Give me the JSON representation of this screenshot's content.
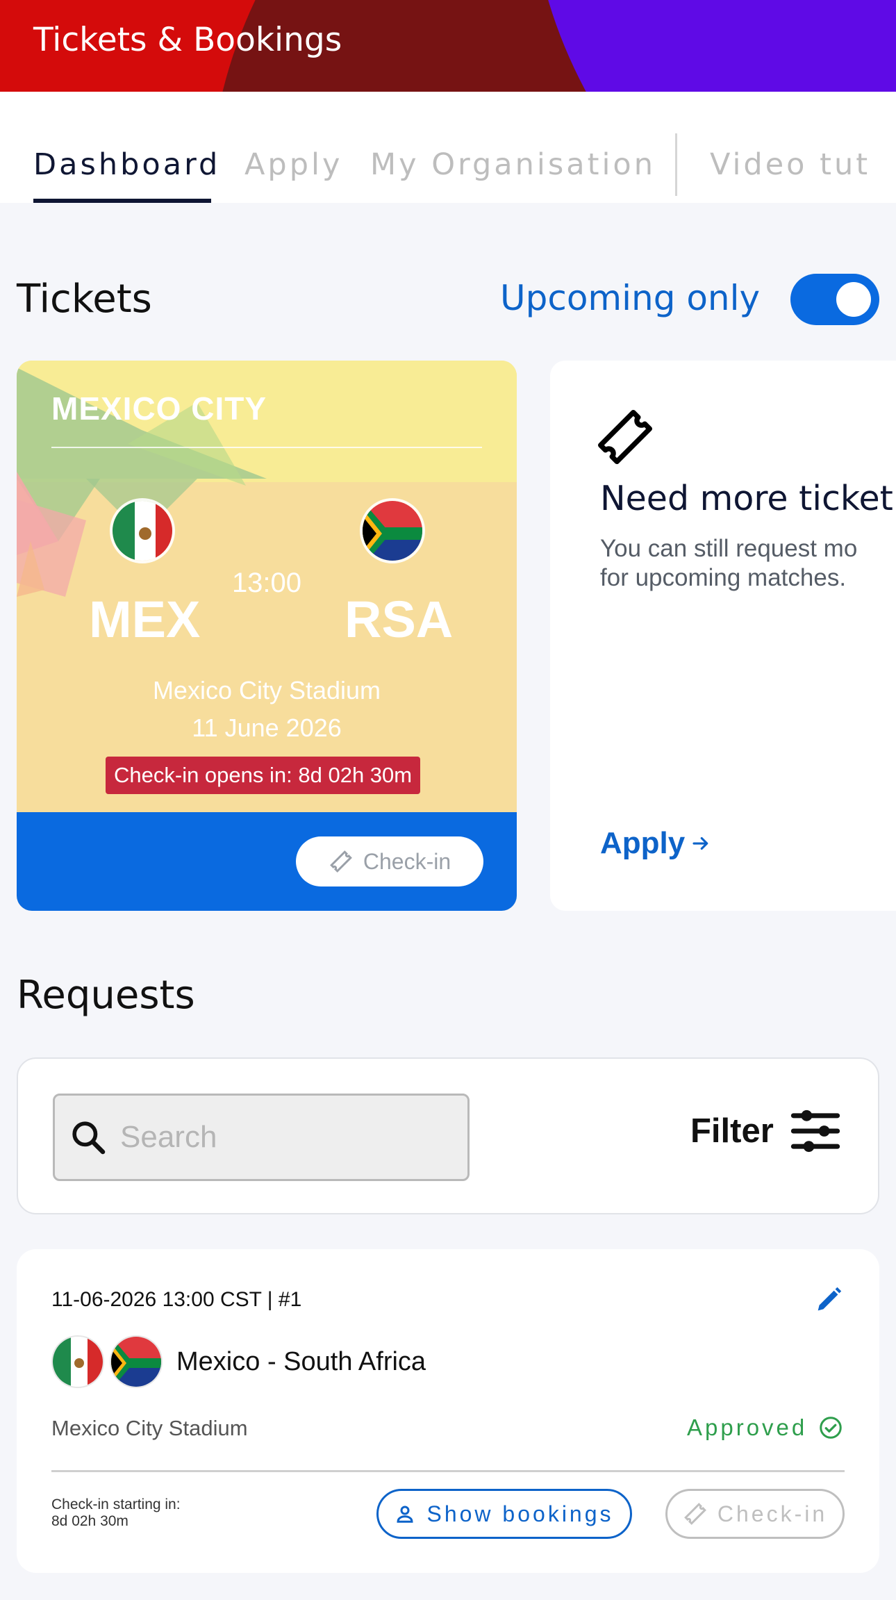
{
  "header": {
    "title": "Tickets & Bookings"
  },
  "tabs": [
    {
      "label": "Dashboard",
      "active": true
    },
    {
      "label": "Apply",
      "active": false
    },
    {
      "label": "My Organisation",
      "active": false
    },
    {
      "label": "Video tut",
      "active": false
    }
  ],
  "tickets": {
    "title": "Tickets",
    "upcoming_label": "Upcoming only",
    "upcoming_enabled": true,
    "card": {
      "city": "MEXICO CITY",
      "home_code": "MEX",
      "away_code": "RSA",
      "time": "13:00",
      "venue": "Mexico City Stadium",
      "date": "11 June 2026",
      "checkin_badge": "Check-in opens in: 8d 02h 30m",
      "checkin_button": "Check-in"
    },
    "more_card": {
      "title": "Need more ticket",
      "desc_line1": "You can still request mo",
      "desc_line2": "for upcoming matches.",
      "apply_label": "Apply"
    }
  },
  "requests": {
    "title": "Requests",
    "search_placeholder": "Search",
    "filter_label": "Filter",
    "items": [
      {
        "header": "11-06-2026 13:00 CST | #1",
        "home_team": "Mexico",
        "separator": "-",
        "away_team": "South Africa",
        "venue": "Mexico City Stadium",
        "status": "Approved",
        "checkin_line1": "Check-in starting in:",
        "checkin_line2": "8d 02h 30m",
        "show_bookings_label": "Show bookings",
        "checkin_label": "Check-in"
      }
    ]
  },
  "colors": {
    "primary_blue": "#0a6ae0",
    "header_red": "#d40b0b",
    "header_maroon": "#761313",
    "header_purple": "#5f0ae6",
    "approved_green": "#2e9e4c",
    "badge_red": "#c7283d"
  }
}
